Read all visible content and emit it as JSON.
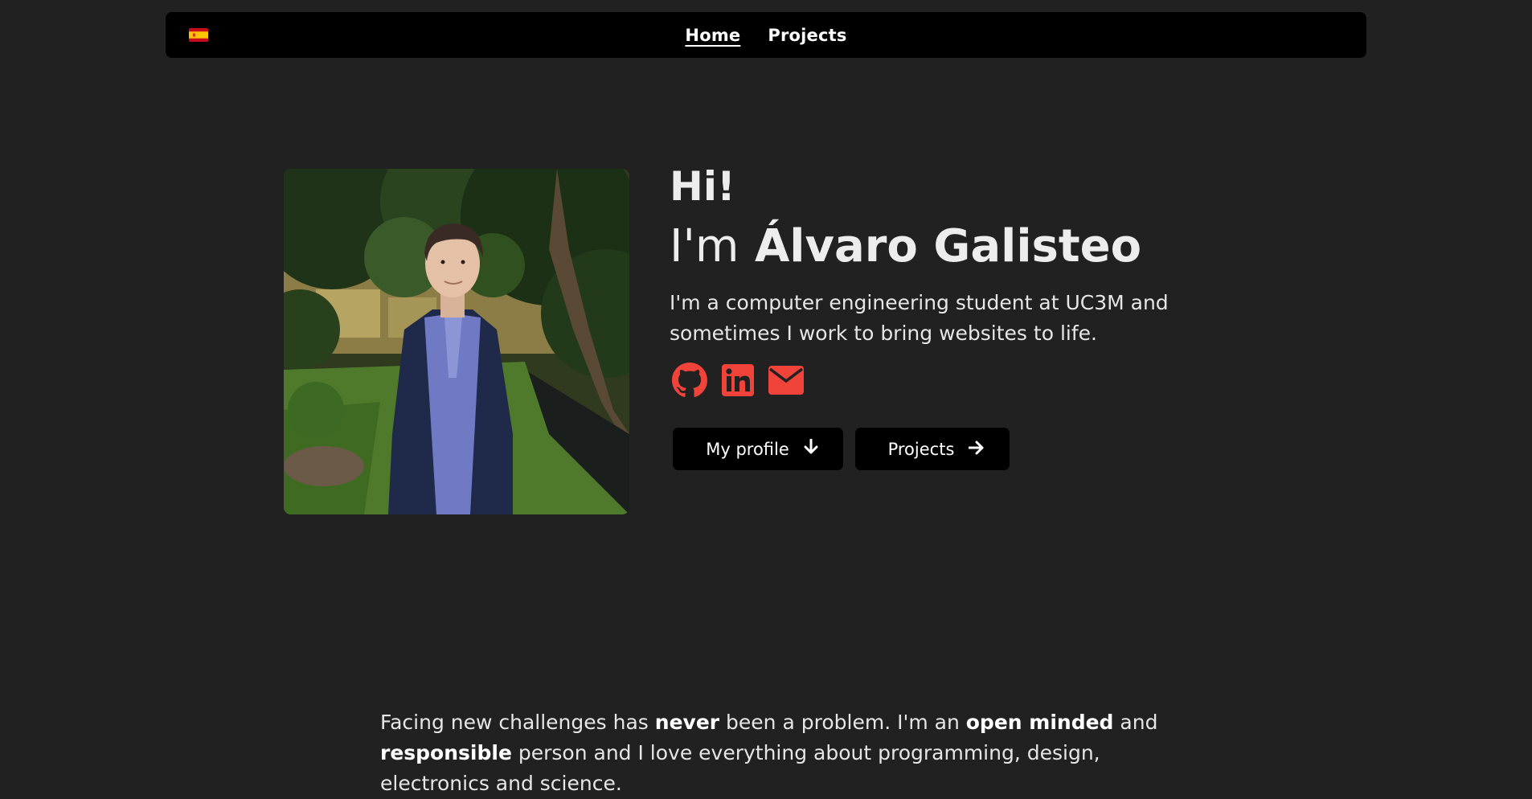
{
  "nav": {
    "language_flag": "spain-flag",
    "links": [
      {
        "label": "Home",
        "active": true
      },
      {
        "label": "Projects",
        "active": false
      }
    ]
  },
  "hero": {
    "greeting": "Hi!",
    "intro_prefix": "I'm",
    "name": "Álvaro Galisteo",
    "tagline": "I'm a computer engineering student at UC3M and sometimes I work to bring websites to life.",
    "socials": [
      {
        "icon": "github-icon"
      },
      {
        "icon": "linkedin-icon"
      },
      {
        "icon": "email-icon"
      }
    ],
    "buttons": {
      "profile_label": "My profile",
      "projects_label": "Projects"
    }
  },
  "about": {
    "p1": "Facing new challenges has ",
    "b1": "never",
    "p2": " been a problem. I'm an ",
    "b2": "open minded",
    "p3": " and ",
    "b3": "responsible",
    "p4": " person and I love everything about programming, design, electronics and science."
  },
  "colors": {
    "background": "#212121",
    "navbar": "#000000",
    "accent": "#f0443a",
    "text": "#e6e6e6"
  }
}
